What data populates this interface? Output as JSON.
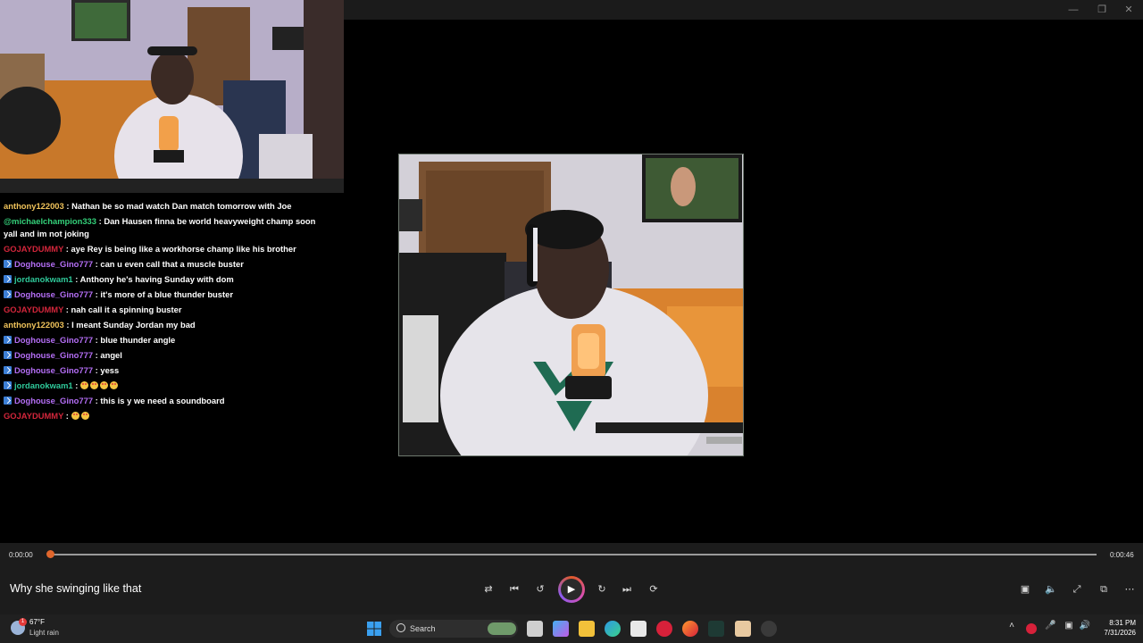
{
  "window": {
    "minimize_icon": "minimize-icon",
    "restore_icon": "restore-icon",
    "close_icon": "close-icon"
  },
  "chat": {
    "messages": [
      {
        "user": "anthony122003",
        "text": " : Nathan be so mad watch Dan match tomorrow with Joe",
        "color": "#f0c35b",
        "badge": false
      },
      {
        "user": "@michaelchampion333",
        "text": " : Dan Hausen finna be world heavyweight champ soon yall and im not joking",
        "color": "#34d17a",
        "badge": false
      },
      {
        "user": "GOJAYDUMMY",
        "text": " : aye Rey is being like a workhorse champ like his brother",
        "color": "#d2263b",
        "badge": false
      },
      {
        "user": "Doghouse_Gino777",
        "text": " : can u even call that a muscle buster",
        "color": "#b46ef5",
        "badge": true
      },
      {
        "user": "jordanokwam1",
        "text": " : Anthony he's having Sunday with dom",
        "color": "#2fc99a",
        "badge": true
      },
      {
        "user": "Doghouse_Gino777",
        "text": " : it's more of a blue thunder buster",
        "color": "#b46ef5",
        "badge": true
      },
      {
        "user": "GOJAYDUMMY",
        "text": " : nah call it a spinning buster",
        "color": "#d2263b",
        "badge": false
      },
      {
        "user": "anthony122003",
        "text": " : I meant Sunday Jordan my bad",
        "color": "#f0c35b",
        "badge": false
      },
      {
        "user": "Doghouse_Gino777",
        "text": " : blue thunder angle",
        "color": "#b46ef5",
        "badge": true
      },
      {
        "user": "Doghouse_Gino777",
        "text": " : angel",
        "color": "#b46ef5",
        "badge": true
      },
      {
        "user": "Doghouse_Gino777",
        "text": " : yess",
        "color": "#b46ef5",
        "badge": true
      },
      {
        "user": "jordanokwam1",
        "text": " : ",
        "color": "#2fc99a",
        "badge": true,
        "emojis": 4
      },
      {
        "user": "Doghouse_Gino777",
        "text": " : this is y we need a soundboard",
        "color": "#b46ef5",
        "badge": true
      },
      {
        "user": "GOJAYDUMMY",
        "text": " : ",
        "color": "#d2263b",
        "badge": false,
        "emojis": 2
      }
    ]
  },
  "player": {
    "current_time": "0:00:00",
    "duration": "0:00:46",
    "progress": 0,
    "title": "Why she swinging like that",
    "accent": "#e0662c"
  },
  "taskbar": {
    "weather_temp": "67°F",
    "weather_desc": "Light rain",
    "weather_badge": "1",
    "search_label": "Search",
    "clock_time": "8:31 PM",
    "clock_date": "7/31/2026"
  }
}
